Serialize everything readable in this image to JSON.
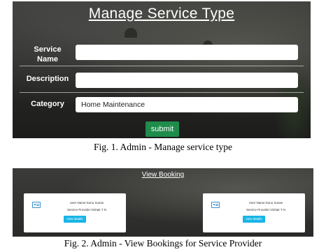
{
  "figure1": {
    "title": "Manage Service Type",
    "fields": [
      {
        "label": "Service Name",
        "value": ""
      },
      {
        "label": "Description",
        "value": ""
      },
      {
        "label": "Category",
        "value": "Home Maintenance"
      }
    ],
    "submit_label": "submit",
    "caption": "Fig. 1. Admin - Manage service type"
  },
  "figure2": {
    "title": "View Booking",
    "cards": [
      {
        "user": "User Name:Sonu Susan",
        "provider": "Service Provider:Vishak T N",
        "button": "view details"
      },
      {
        "user": "User Name:Sonu Susan",
        "provider": "Service Provider:Vishak T N",
        "button": "view details"
      }
    ],
    "caption": "Fig. 2. Admin - View Bookings for Service Provider"
  },
  "colors": {
    "submit": "#1e8c4a",
    "view_button": "#19b5e6",
    "card_icon": "#3a8fd0"
  },
  "icons": [
    "id-card-icon"
  ]
}
